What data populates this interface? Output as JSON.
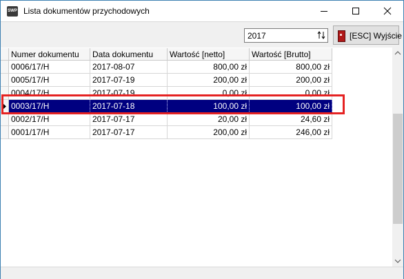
{
  "window": {
    "app_icon_text": "SWP",
    "title": "Lista dokumentów przychodowych"
  },
  "toolbar": {
    "year_value": "2017",
    "exit_label": "[ESC] Wyjście"
  },
  "grid": {
    "columns": [
      "Numer dokumentu",
      "Data dokumentu",
      "Wartość [netto]",
      "Wartość [Brutto]"
    ],
    "rows": [
      {
        "numer": "0006/17/H",
        "data": "2017-08-07",
        "netto": "800,00 zł",
        "brutto": "800,00 zł"
      },
      {
        "numer": "0005/17/H",
        "data": "2017-07-19",
        "netto": "200,00 zł",
        "brutto": "200,00 zł"
      },
      {
        "numer": "0004/17/H",
        "data": "2017-07-19",
        "netto": "0,00 zł",
        "brutto": "0,00 zł"
      },
      {
        "numer": "0003/17/H",
        "data": "2017-07-18",
        "netto": "100,00 zł",
        "brutto": "100,00 zł"
      },
      {
        "numer": "0002/17/H",
        "data": "2017-07-17",
        "netto": "20,00 zł",
        "brutto": "24,60 zł"
      },
      {
        "numer": "0001/17/H",
        "data": "2017-07-17",
        "netto": "200,00 zł",
        "brutto": "246,00 zł"
      }
    ],
    "selected_row": 3
  },
  "colors": {
    "selection": "#000080",
    "highlight_box": "#e52222"
  }
}
